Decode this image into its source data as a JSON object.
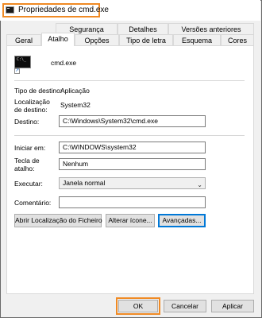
{
  "window": {
    "title": "Propriedades de cmd.exe",
    "accent": "#f08a24"
  },
  "tabs_row1": [
    {
      "label": "Segurança"
    },
    {
      "label": "Detalhes"
    },
    {
      "label": "Versões anteriores"
    }
  ],
  "tabs_row2": [
    {
      "label": "Geral"
    },
    {
      "label": "Atalho"
    },
    {
      "label": "Opções"
    },
    {
      "label": "Tipo de letra"
    },
    {
      "label": "Esquema"
    },
    {
      "label": "Cores"
    }
  ],
  "shortcut": {
    "name": "cmd.exe",
    "icon": "command-prompt-icon",
    "target_type_label": "Tipo de destino:",
    "target_type_value": "Aplicação",
    "target_location_label_1": "Localização",
    "target_location_label_2": "de destino:",
    "target_location_value": "System32",
    "target_label": "Destino:",
    "target_value": "C:\\Windows\\System32\\cmd.exe",
    "start_in_label": "Iniciar em:",
    "start_in_value": "C:\\WINDOWS\\system32",
    "hotkey_label_1": "Tecla de",
    "hotkey_label_2": "atalho:",
    "hotkey_value": "Nenhum",
    "run_label": "Executar:",
    "run_value": "Janela normal",
    "comment_label": "Comentário:",
    "comment_value": ""
  },
  "buttons": {
    "open_location": "Abrir Localização do Ficheiro",
    "change_icon": "Alterar ícone...",
    "advanced": "Avançadas...",
    "ok": "OK",
    "cancel": "Cancelar",
    "apply": "Aplicar"
  }
}
